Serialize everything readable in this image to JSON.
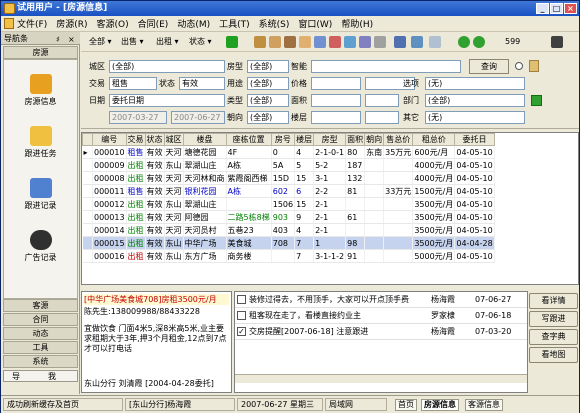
{
  "window": {
    "title": "试用用户 - [房源信息]"
  },
  "menu": [
    "文件(F)",
    "房源(R)",
    "客源(O)",
    "合同(E)",
    "动态(M)",
    "工具(T)",
    "系统(S)",
    "窗口(W)",
    "帮助(H)"
  ],
  "sidebar": {
    "title": "导航条",
    "pin": "♯",
    "close": "×",
    "section": "房源",
    "items": [
      "房源信息",
      "跟进任务",
      "跟进记录",
      "广告记录"
    ],
    "bottom_sections": [
      "客源",
      "合同",
      "动态",
      "工具",
      "系统"
    ],
    "bottom_tabs": [
      "导",
      "我"
    ]
  },
  "toolbar": {
    "all": "全部",
    "sale": "出售",
    "rent": "出租",
    "status": "状态",
    "count": "599"
  },
  "filter": {
    "district_label": "城区",
    "district_val": "(全部)",
    "type_label": "房型",
    "type_val": "(全部)",
    "smart_label": "智能",
    "smart_val": "",
    "query_btn": "查询",
    "trade_label": "交易",
    "trade_val": "租售",
    "state_label": "状态",
    "state_val": "有效",
    "usage_label": "用途",
    "usage_val": "(全部)",
    "price_label": "价格",
    "price_val": "",
    "option_label": "选项",
    "option_val": "(无)",
    "date_label": "日期",
    "date_val": "委托日期",
    "category_label": "类型",
    "category_val": "(全部)",
    "area_label": "面积",
    "area_val": "",
    "dept_label": "部门",
    "dept_val": "(全部)",
    "date_from": "2007-03-27",
    "date_to": "2007-06-27",
    "facing_label": "朝向",
    "facing_val": "(全部)",
    "floor_label": "楼层",
    "floor_val": "",
    "other_label": "其它",
    "other_val": "(无)"
  },
  "grid": {
    "columns": [
      "编号",
      "交易",
      "状态",
      "城区",
      "楼盘",
      "座栋位置",
      "房号",
      "楼层",
      "房型",
      "面积",
      "朝向",
      "售总价",
      "租总价",
      "委托日"
    ],
    "rows": [
      [
        "000010",
        "租售",
        "有效",
        "天河",
        "塘德花园",
        "4F",
        "0",
        "4",
        "2-1-0-1",
        "80",
        "东南",
        "35万元",
        "600元/月",
        "04-05-10"
      ],
      [
        "000009",
        "出租",
        "有效",
        "东山",
        "翠湖山庄",
        "A栋",
        "5A",
        "5",
        "5-2",
        "187",
        "",
        "",
        "4000元/月",
        "04-05-10"
      ],
      [
        "000008",
        "出租",
        "有效",
        "天河",
        "天河林和商",
        "紫霞阁西梯",
        "15D",
        "15",
        "3-1",
        "132",
        "",
        "",
        "4000元/月",
        "04-05-10"
      ],
      [
        "000011",
        "租售",
        "有效",
        "天河",
        "银利花园",
        "A栋",
        "602",
        "6",
        "2-2",
        "81",
        "",
        "33万元",
        "1500元/月",
        "04-05-10"
      ],
      [
        "000012",
        "出租",
        "有效",
        "东山",
        "翠湖山庄",
        "",
        "1506",
        "15",
        "2-1",
        "",
        "",
        "",
        "3500元/月",
        "04-05-10"
      ],
      [
        "000013",
        "出租",
        "有效",
        "天河",
        "阿德园",
        "二路5栋8梯",
        "903",
        "9",
        "2-1",
        "61",
        "",
        "",
        "3500元/月",
        "04-05-10"
      ],
      [
        "000014",
        "出租",
        "有效",
        "天河",
        "天河员村",
        "五巷23",
        "403",
        "4",
        "2-1",
        "",
        "",
        "",
        "3500元/月",
        "04-05-10"
      ],
      [
        "000015",
        "出租",
        "有效",
        "东山",
        "中华广场",
        "美食城",
        "708",
        "7",
        "1",
        "98",
        "",
        "",
        "3500元/月",
        "04-04-28"
      ],
      [
        "000016",
        "出租",
        "有效",
        "东山",
        "东方广场",
        "商务楼",
        "",
        "7",
        "3-1-1-2",
        "91",
        "",
        "",
        "5000元/月",
        "04-05-10"
      ]
    ]
  },
  "detail": {
    "headline": "[中华广场美食城708]房租3500元/月",
    "contact": "陈先生:138009988/88433228",
    "desc": "宜做饮食 门面4米5,深8米高5米,业主要求租期大于3年,押3个月租金,12点到7点才可以打电话",
    "footer": "东山分行  刘清霞   [2004-04-28委托]"
  },
  "notes": [
    {
      "checked": false,
      "text": "装修过得去，不用顶手，大家可以开点顶手费",
      "person": "杨海霞",
      "date": "07-06-27"
    },
    {
      "checked": false,
      "text": "租客现在走了，看楼直接约业主",
      "person": "罗家棣",
      "date": "07-06-18"
    },
    {
      "checked": true,
      "text": "交房提醒[2007-06-18] 注意跟进",
      "person": "杨海霞",
      "date": "07-03-20"
    }
  ],
  "buttons": [
    "看详情",
    "写跟进",
    "查字典",
    "看地图"
  ],
  "status": {
    "msg": "成功刷新缓存及首页",
    "branch": "[东山分行]杨海霞",
    "date": "2007-06-27 星期三",
    "network": "局域网",
    "tabs": [
      "首页",
      "房源信息",
      "客源信息"
    ]
  },
  "colors": {
    "title": "#1950c4",
    "selected_row": "#c6d3ee",
    "sale": "#0000c8",
    "rent": "#008000",
    "headline": "#c00000"
  }
}
